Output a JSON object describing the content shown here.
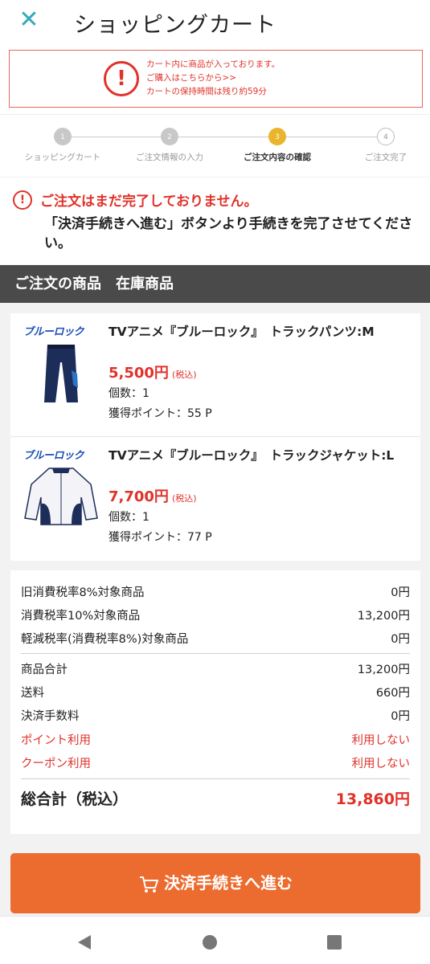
{
  "header": {
    "title": "ショッピングカート",
    "close_icon": "close-icon"
  },
  "notice": {
    "line1": "カート内に商品が入っております。",
    "line2": "ご購入はこちらから>>",
    "line3": "カートの保持時間は残り約59分",
    "icon": "exclamation-icon"
  },
  "steps": [
    {
      "num": "1",
      "label": "ショッピングカート",
      "state": "done"
    },
    {
      "num": "2",
      "label": "ご注文情報の入力",
      "state": "done"
    },
    {
      "num": "3",
      "label": "ご注文内容の確認",
      "state": "active"
    },
    {
      "num": "4",
      "label": "ご注文完了",
      "state": "todo"
    }
  ],
  "warning": {
    "title": "ご注文はまだ完了しておりません。",
    "body": "「決済手続きへ進む」ボタンより手続きを完了させてください。"
  },
  "section_title": "ご注文の商品　在庫商品",
  "items": [
    {
      "brand": "ブルーロック",
      "name": "TVアニメ『ブルーロック』　トラックパンツ:M",
      "price": "5,500円",
      "tax": "(税込)",
      "qty": "個数：1",
      "points": "獲得ポイント：55 P"
    },
    {
      "brand": "ブルーロック",
      "name": "TVアニメ『ブルーロック』　トラックジャケット:L",
      "price": "7,700円",
      "tax": "(税込)",
      "qty": "個数：1",
      "points": "獲得ポイント：77 P"
    }
  ],
  "summary": {
    "old_tax_label": "旧消費税率8%対象商品",
    "old_tax_value": "0円",
    "tax10_label": "消費税率10%対象商品",
    "tax10_value": "13,200円",
    "reduced_label": "軽減税率(消費税率8%)対象商品",
    "reduced_value": "0円",
    "subtotal_label": "商品合計",
    "subtotal_value": "13,200円",
    "shipping_label": "送料",
    "shipping_value": "660円",
    "fee_label": "決済手数料",
    "fee_value": "0円",
    "points_label": "ポイント利用",
    "points_value": "利用しない",
    "coupon_label": "クーポン利用",
    "coupon_value": "利用しない",
    "total_label": "総合計（税込）",
    "total_value": "13,860円"
  },
  "checkout_label": "決済手続きへ進む",
  "colors": {
    "accent": "#ec6b2e",
    "red": "#e0322a",
    "teal": "#33aabb",
    "step_active": "#e8b52c"
  }
}
